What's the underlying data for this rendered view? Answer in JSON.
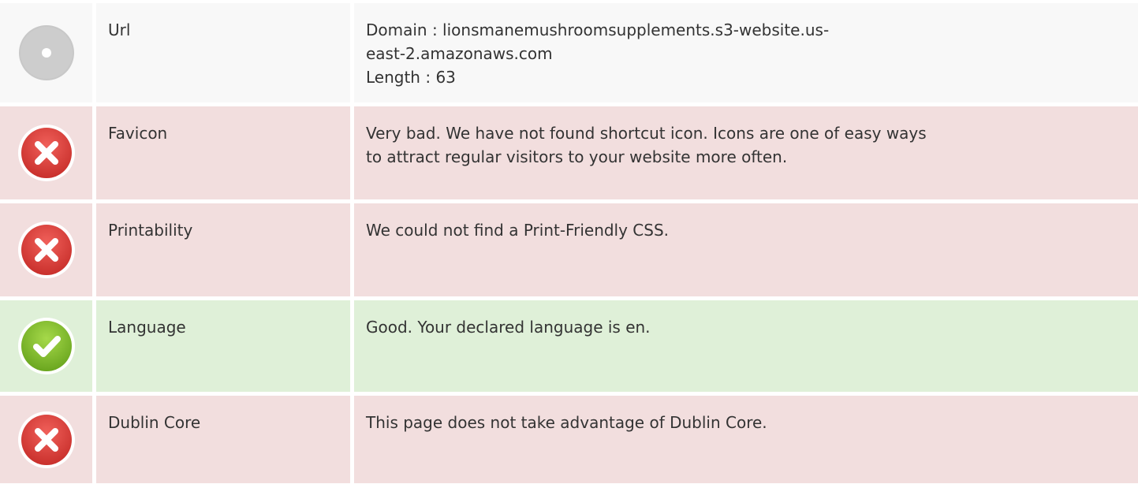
{
  "rows": [
    {
      "status": "neutral",
      "icon": "neutral-dot-icon",
      "label": "Url",
      "lines": [
        "Domain : lionsmanemushroomsupplements.s3-website.us-",
        "east-2.amazonaws.com",
        "Length : 63"
      ]
    },
    {
      "status": "bad",
      "icon": "error-x-icon",
      "label": "Favicon",
      "lines": [
        "Very bad. We have not found shortcut icon. Icons are one of easy ways",
        "to attract regular visitors to your website more often."
      ]
    },
    {
      "status": "bad",
      "icon": "error-x-icon",
      "label": "Printability",
      "lines": [
        "We could not find a Print-Friendly CSS."
      ]
    },
    {
      "status": "good",
      "icon": "check-icon",
      "label": "Language",
      "lines": [
        "Good. Your declared language is en."
      ]
    },
    {
      "status": "bad",
      "icon": "error-x-icon",
      "label": "Dublin Core",
      "lines": [
        "This page does not take advantage of Dublin Core."
      ]
    }
  ],
  "colors": {
    "bad_bg": "#f2dede",
    "good_bg": "#dff0d8",
    "neutral_bg": "#f8f8f8",
    "error_red": "#d9534f",
    "success_green": "#8cc63f",
    "neutral_gray": "#c8c8c8"
  }
}
